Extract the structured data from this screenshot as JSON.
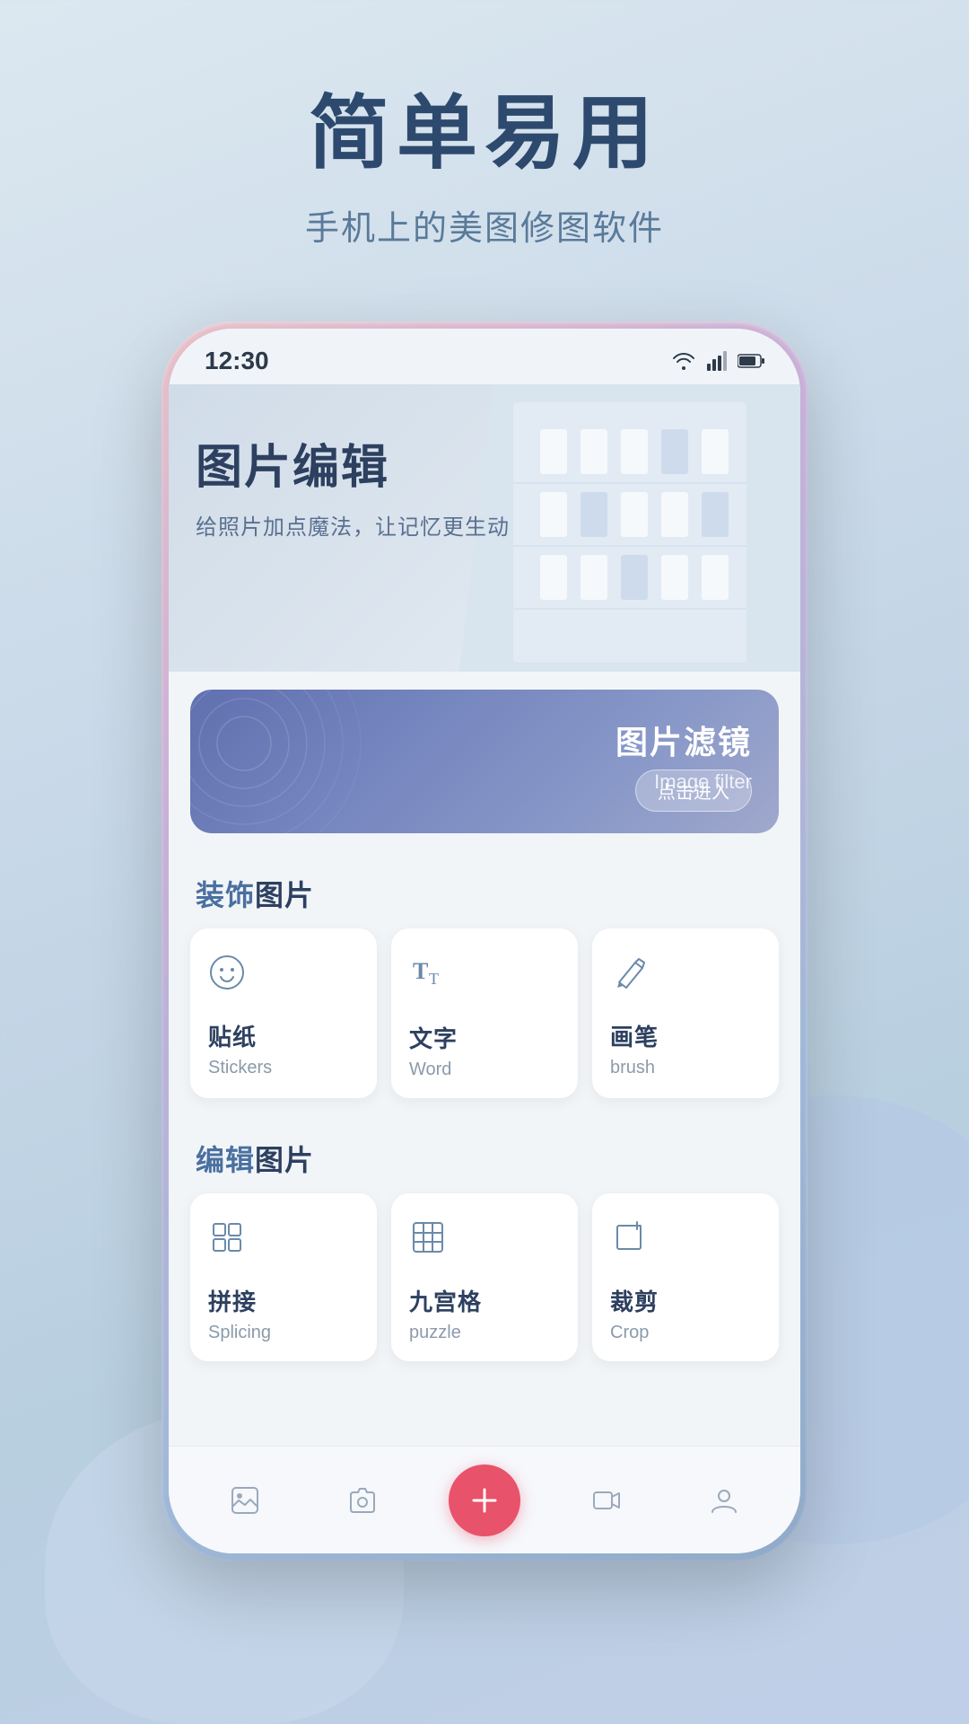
{
  "header": {
    "title": "简单易用",
    "subtitle": "手机上的美图修图软件"
  },
  "phone": {
    "status_bar": {
      "time": "12:30"
    },
    "hero": {
      "title": "图片编辑",
      "description": "给照片加点魔法，让记忆更生动"
    },
    "filter_card": {
      "title": "图片滤镜",
      "subtitle": "Image filter",
      "button": "点击进入"
    },
    "sections": [
      {
        "id": "decorate",
        "title_bold": "装饰",
        "title_rest": "图片",
        "items": [
          {
            "id": "stickers",
            "icon": "😊",
            "name_cn": "贴纸",
            "name_en": "Stickers"
          },
          {
            "id": "word",
            "icon": "Tₜ",
            "name_cn": "文字",
            "name_en": "Word"
          },
          {
            "id": "brush",
            "icon": "✏",
            "name_cn": "画笔",
            "name_en": "brush"
          }
        ]
      },
      {
        "id": "edit",
        "title_bold": "编辑",
        "title_rest": "图片",
        "items": [
          {
            "id": "splicing",
            "icon": "⊞",
            "name_cn": "拼接",
            "name_en": "Splicing"
          },
          {
            "id": "puzzle",
            "icon": "#",
            "name_cn": "九宫格",
            "name_en": "puzzle"
          },
          {
            "id": "crop",
            "icon": "⊡",
            "name_cn": "裁剪",
            "name_en": "Crop"
          }
        ]
      }
    ],
    "tab_bar": {
      "items": [
        {
          "id": "gallery",
          "icon": "🖼",
          "active": false
        },
        {
          "id": "camera",
          "icon": "📷",
          "active": false
        },
        {
          "id": "home",
          "icon": "●",
          "active": true
        },
        {
          "id": "video",
          "icon": "🎬",
          "active": false
        },
        {
          "id": "profile",
          "icon": "👤",
          "active": false
        }
      ]
    }
  },
  "colors": {
    "bg_start": "#dce8f0",
    "bg_end": "#b8cfe0",
    "title": "#2d4a6e",
    "subtitle": "#5a7a9a",
    "phone_gradient_start": "#e8c0c8",
    "phone_gradient_end": "#90aac8",
    "filter_card_start": "#6070b0",
    "filter_card_end": "#a0a8cc",
    "accent_red": "#e8526a"
  }
}
